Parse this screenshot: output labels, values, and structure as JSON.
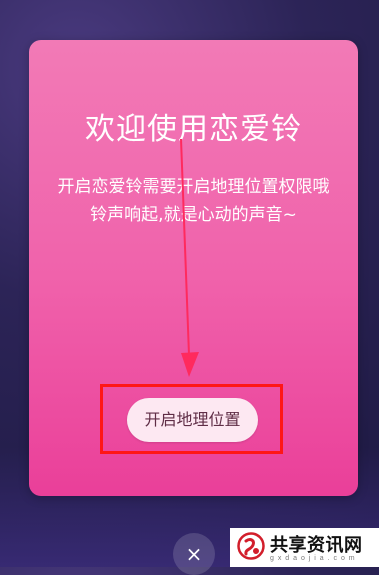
{
  "modal": {
    "title": "欢迎使用恋爱铃",
    "description_line1": "开启恋爱铃需要开启地理位置权限哦",
    "description_line2": "铃声响起,就是心动的声音~",
    "button_label": "开启地理位置",
    "colors": {
      "accent": "#f062ab",
      "button_bg": "#fde8f2",
      "highlight_box": "#ff1616",
      "annotation_arrow": "#ff2a5e"
    }
  },
  "close": {
    "icon": "close-icon",
    "label": "×"
  },
  "watermark": {
    "main_text": "共享资讯网",
    "sub_text": "g x d a o j i a . c o m"
  }
}
